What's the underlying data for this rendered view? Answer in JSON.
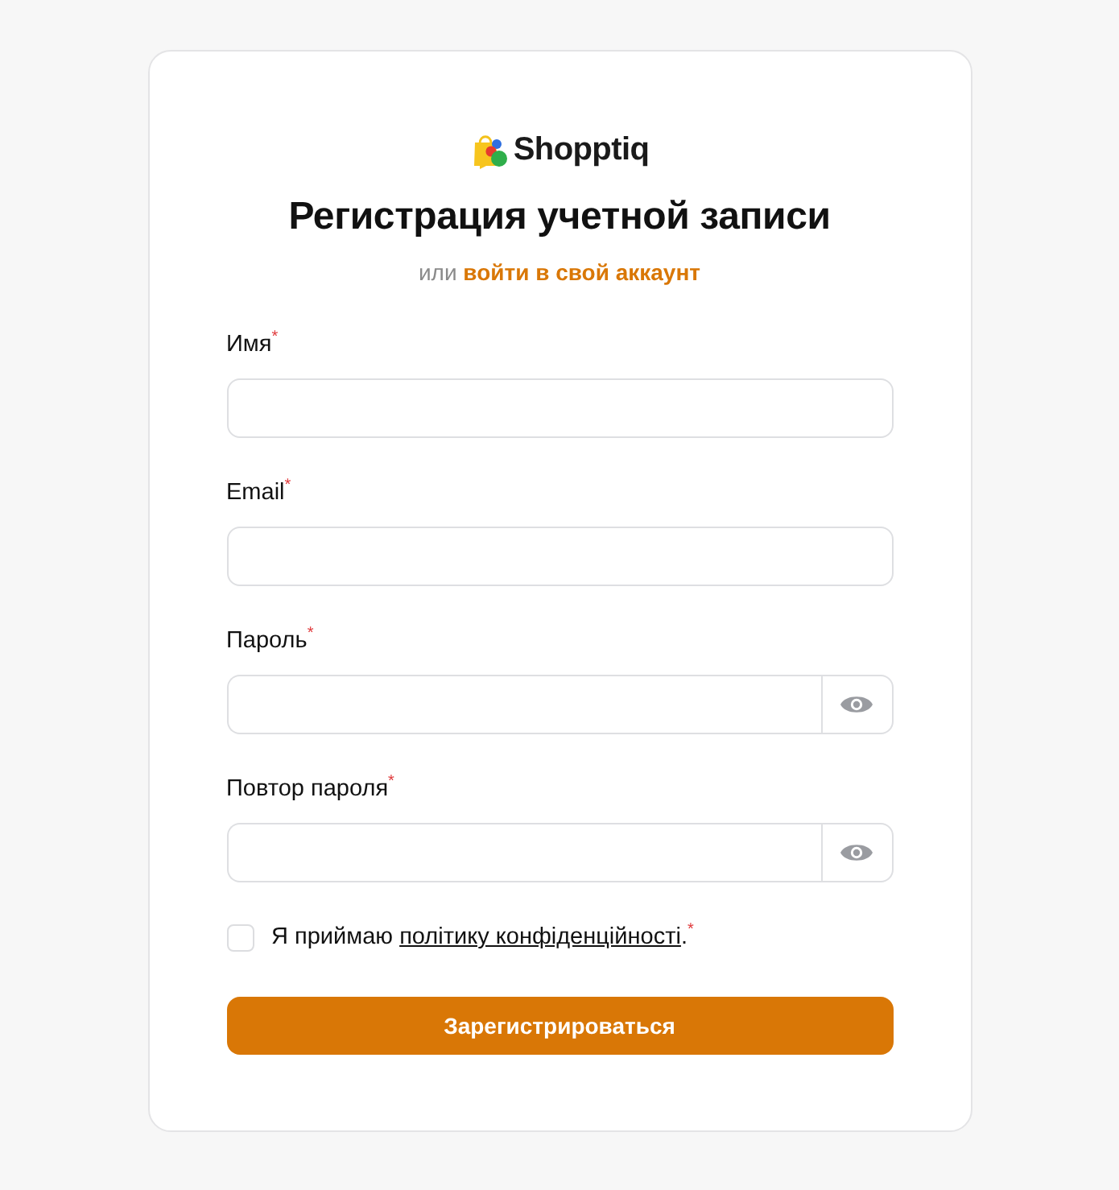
{
  "logo": {
    "name": "Shopptiq"
  },
  "title": "Регистрация учетной записи",
  "subtitle": {
    "text": "или",
    "link": "войти в свой аккаунт"
  },
  "fields": [
    {
      "label": "Имя$^{*}$",
      "kind": "text"
    },
    {
      "label": "Email$^{*}$",
      "kind": "text"
    },
    {
      "label": "Пароль$^{*}$",
      "kind": "password"
    },
    {
      "label": "Повтор пароля$^{*}$",
      "kind": "password"
    }
  ],
  "consent": {
    "checked": false,
    "text": "Я приймаю",
    "link": "політику конфіденційності",
    "after": ".$^{*}$"
  },
  "submit": "Зарегистрироваться"
}
